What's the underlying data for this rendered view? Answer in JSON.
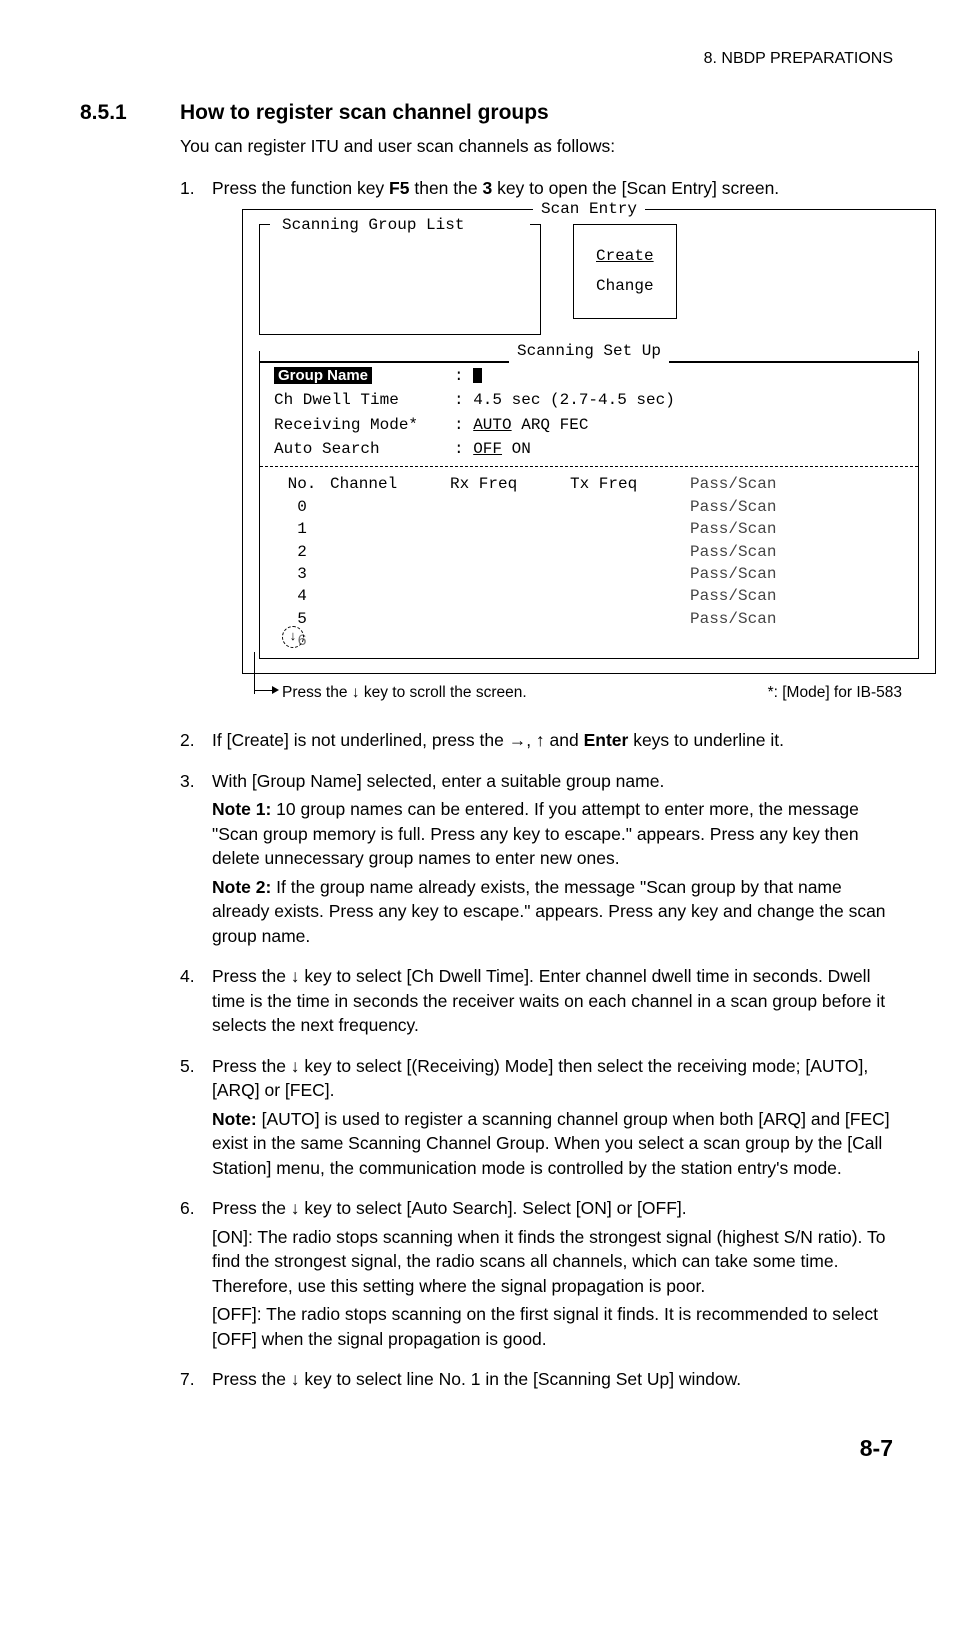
{
  "header": {
    "running": "8.  NBDP PREPARATIONS"
  },
  "section": {
    "num": "8.5.1",
    "title": "How to register scan channel groups"
  },
  "intro": "You can register ITU and user scan channels as follows:",
  "steps": {
    "s1": {
      "n": "1.",
      "t": "Press the function key <b>F5</b> then the <b>3</b> key to open the [Scan Entry] screen."
    },
    "s2": {
      "n": "2.",
      "t": "If [Create] is not underlined, press the →, ↑ and <b>Enter</b> keys to underline it."
    },
    "s3": {
      "n": "3.",
      "t": "With [Group Name] selected, enter a suitable group name.",
      "note1": "<b>Note 1:</b> 10 group names can be entered. If you attempt to enter more, the message \"Scan group memory is full. Press any key to escape.\" appears. Press any key then delete unnecessary group names to enter new ones.",
      "note2": "<b>Note 2:</b> If the group name already exists, the message \"Scan group by that name already exists. Press any key to escape.\" appears. Press any key and change the scan group name."
    },
    "s4": {
      "n": "4.",
      "t": "Press the ↓ key to select [Ch Dwell Time]. Enter channel dwell time in seconds. Dwell time is the time in seconds the receiver waits on each channel in a scan group before it selects the next frequency."
    },
    "s5": {
      "n": "5.",
      "t": "Press the ↓ key to select [(Receiving) Mode] then select the receiving mode; [AUTO], [ARQ] or [FEC].",
      "note": "<b>Note:</b> [AUTO] is used to register a scanning channel group when both [ARQ] and [FEC] exist in the same Scanning Channel Group. When you select a scan group by the [Call Station] menu, the communication mode is controlled by the station entry's mode."
    },
    "s6": {
      "n": "6.",
      "t": "Press the ↓ key to select [Auto Search]. Select [ON] or [OFF].",
      "on": "[ON]: The radio stops scanning when it finds the strongest signal (highest S/N ratio). To find the strongest signal, the radio scans all channels, which can take some time. Therefore, use this setting where the signal propagation is poor.",
      "off": "[OFF]: The radio stops scanning on the first signal it finds. It is recommended to select [OFF] when the signal propagation is good."
    },
    "s7": {
      "n": "7.",
      "t": "Press the ↓ key to select line No. 1 in the [Scanning Set Up] window."
    }
  },
  "figure": {
    "outer_title": "Scan Entry",
    "sgl_title": "Scanning Group List",
    "create": "Create",
    "change": "Change",
    "setup_title": "Scanning Set Up",
    "group_name_label": "Group Name",
    "dwell_label": "Ch Dwell Time",
    "dwell_val": "4.5 sec (2.7-4.5 sec)",
    "mode_label": "Receiving Mode*",
    "mode_val_ul": "AUTO",
    "mode_val_rest": " ARQ FEC",
    "auto_label": "Auto Search",
    "auto_val_ul": "OFF",
    "auto_val_rest": " ON",
    "col_no": "No.",
    "col_ch": "Channel",
    "col_rx": "Rx Freq",
    "col_tx": "Tx Freq",
    "col_ps": "Pass/Scan",
    "rows": [
      "0",
      "1",
      "2",
      "3",
      "4",
      "5"
    ],
    "row6": "6",
    "scroll_caption": "Press the ↓ key to scroll the screen.",
    "mode_note": "*: [Mode] for IB-583"
  },
  "page": "8-7",
  "chart_data": null
}
